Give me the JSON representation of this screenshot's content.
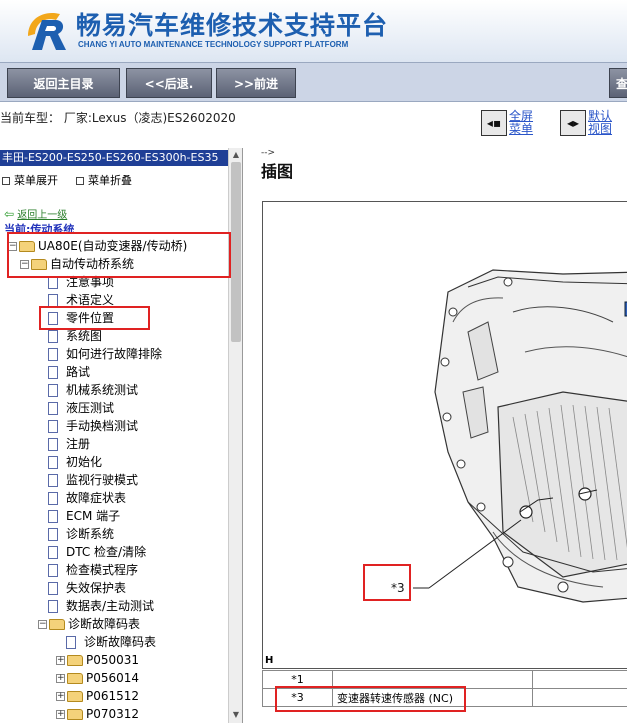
{
  "header": {
    "title": "畅易汽车维修技术支持平台",
    "subtitle": "CHANG YI AUTO MAINTENANCE TECHNOLOGY SUPPORT PLATFORM"
  },
  "toolbar": {
    "home_label": "返回主目录",
    "back_label": "<<后退.",
    "forward_label": ">>前进",
    "search_label": "查"
  },
  "infobar": {
    "car_model": "当前车型：  厂家:Lexus（凌志)ES2602020",
    "fullscreen_label": "全屏菜单",
    "default_view_label": "默认视图"
  },
  "sidebar": {
    "model_title": "丰田-ES200-ES250-ES260-ES300h-ES35",
    "expand_label": "菜单展开",
    "collapse_label": "菜单折叠",
    "back_up_label": "返回上一级",
    "current_system": "当前:传动系统",
    "tree": [
      {
        "label": "UA80E(自动变速器/传动桥)",
        "type": "folder",
        "level": 0
      },
      {
        "label": "自动传动桥系统",
        "type": "folder",
        "level": 1
      },
      {
        "label": "注意事项",
        "type": "doc",
        "level": 2
      },
      {
        "label": "术语定义",
        "type": "doc",
        "level": 2
      },
      {
        "label": "零件位置",
        "type": "doc",
        "level": 2
      },
      {
        "label": "系统图",
        "type": "doc",
        "level": 2
      },
      {
        "label": "如何进行故障排除",
        "type": "doc",
        "level": 2
      },
      {
        "label": "路试",
        "type": "doc",
        "level": 2
      },
      {
        "label": "机械系统测试",
        "type": "doc",
        "level": 2
      },
      {
        "label": "液压测试",
        "type": "doc",
        "level": 2
      },
      {
        "label": "手动换档测试",
        "type": "doc",
        "level": 2
      },
      {
        "label": "注册",
        "type": "doc",
        "level": 2
      },
      {
        "label": "初始化",
        "type": "doc",
        "level": 2
      },
      {
        "label": "监视行驶模式",
        "type": "doc",
        "level": 2
      },
      {
        "label": "故障症状表",
        "type": "doc",
        "level": 2
      },
      {
        "label": "ECM 端子",
        "type": "doc",
        "level": 2
      },
      {
        "label": "诊断系统",
        "type": "doc",
        "level": 2
      },
      {
        "label": "DTC 检查/清除",
        "type": "doc",
        "level": 2
      },
      {
        "label": "检查模式程序",
        "type": "doc",
        "level": 2
      },
      {
        "label": "失效保护表",
        "type": "doc",
        "level": 2
      },
      {
        "label": "数据表/主动测试",
        "type": "doc",
        "level": 2
      },
      {
        "label": "诊断故障码表",
        "type": "folder",
        "level": 2
      },
      {
        "label": "诊断故障码表",
        "type": "doc",
        "level": 3
      },
      {
        "label": "P050031",
        "type": "folder",
        "level": 3
      },
      {
        "label": "P056014",
        "type": "folder",
        "level": 3
      },
      {
        "label": "P061512",
        "type": "folder",
        "level": 3
      },
      {
        "label": "P070312",
        "type": "folder",
        "level": 3
      }
    ]
  },
  "content": {
    "comment": "-->",
    "section_title": "插图",
    "callout": "*3",
    "frame_label": "H",
    "parts_table": [
      {
        "num": "*1",
        "name": ""
      },
      {
        "num": "*3",
        "name": "变速器转速传感器 (NC)"
      }
    ]
  },
  "colors": {
    "brand_blue": "#1d5fb0",
    "model_bar": "#1f3f96",
    "toolbar_button": "#6b7183",
    "highlight_red": "#e02222"
  }
}
